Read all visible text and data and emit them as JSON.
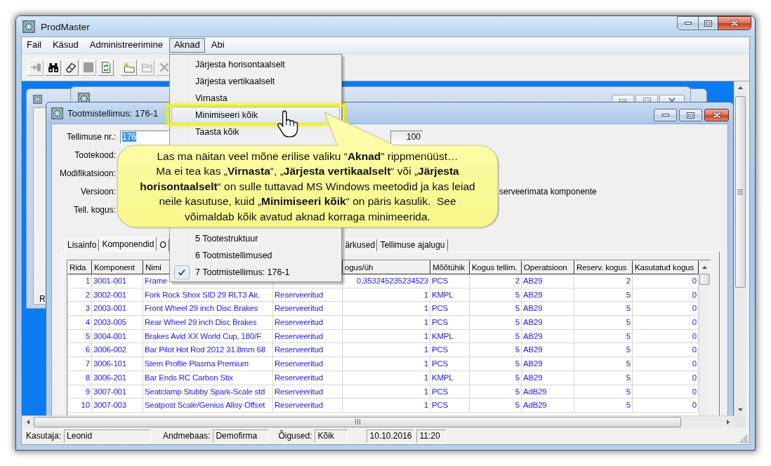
{
  "window": {
    "title": "ProdMaster"
  },
  "menu": [
    {
      "label": "Fail",
      "selected": false
    },
    {
      "label": "Käsud",
      "selected": false
    },
    {
      "label": "Administreerimine",
      "selected": false
    },
    {
      "label": "Aknad",
      "selected": true
    },
    {
      "label": "Abi",
      "selected": false
    }
  ],
  "toolbar": [
    {
      "kind": "enter",
      "disabled": true
    },
    {
      "kind": "binoculars",
      "disabled": false
    },
    {
      "kind": "eraser",
      "disabled": false
    },
    {
      "kind": "stop",
      "disabled": true
    },
    {
      "kind": "refresh",
      "disabled": false
    },
    {
      "kind": "new-folder",
      "disabled": false
    },
    {
      "kind": "folder",
      "disabled": true
    },
    {
      "kind": "delete",
      "disabled": true
    }
  ],
  "background_window": {
    "text": "R"
  },
  "document_window": {
    "title": "Tootmistellimus: 176-1",
    "fields": [
      {
        "label": "Tellimuse nr.:",
        "value": "176",
        "text_selected": true
      },
      {
        "label": "Tootekood:"
      },
      {
        "label": "Modifikatsioon:"
      },
      {
        "label": "Versioon:"
      },
      {
        "label": "Tell. kogus:"
      }
    ],
    "side_fields": [
      {
        "value": "100",
        "disabled": false
      }
    ],
    "option_text": "serveerimata komponente",
    "tabs": [
      {
        "label": "Lisainfo",
        "selected": false
      },
      {
        "label": "Komponendid",
        "selected": true
      },
      {
        "label": "O",
        "selected": false
      },
      {
        "label": "ärkused",
        "selected": false
      },
      {
        "label": "Tellimuse ajalugu",
        "selected": false
      }
    ],
    "table": {
      "columns": {
        "rida": "Rida",
        "komponent": "Komponent",
        "nimi": "Nimi",
        "kogus_uh": "ogus/üh",
        "mootuhik": "Mõõtühik",
        "kogus_tellim": "Kogus tellim.",
        "operatsioon": "Operatsioon",
        "reserv_kogus": "Reserv. kogus",
        "kasutatud_kogus": "Kasutatud kogus"
      },
      "rows": [
        {
          "rida": "1",
          "komponent": "3001-001",
          "nimi": "Frame",
          "kogus_uh": "0,353245235234523",
          "mootuhik": "PCS",
          "kogus_tellim": "2",
          "operatsioon": "AB29",
          "reserv_kogus": "2",
          "kasutatud_kogus": "0"
        },
        {
          "rida": "2",
          "komponent": "3002-001",
          "nimi": "Fork Rock Shox SID 29 RLT3 Air,",
          "column_4": "Reserveeritud",
          "kogus_uh": "1",
          "mootuhik": "KMPL",
          "kogus_tellim": "5",
          "operatsioon": "AB29",
          "reserv_kogus": "5",
          "kasutatud_kogus": "0"
        },
        {
          "rida": "3",
          "komponent": "2003-001",
          "nimi": "Front Wheel 29 inch Disc Brakes",
          "column_4": "Reserveeritud",
          "kogus_uh": "1",
          "mootuhik": "PCS",
          "kogus_tellim": "5",
          "operatsioon": "AB29",
          "reserv_kogus": "5",
          "kasutatud_kogus": "0"
        },
        {
          "rida": "4",
          "komponent": "2003-005",
          "nimi": "Rear Wheel 29 inch Disc Brakes",
          "column_4": "Reserveeritud",
          "kogus_uh": "1",
          "mootuhik": "PCS",
          "kogus_tellim": "5",
          "operatsioon": "AB29",
          "reserv_kogus": "5",
          "kasutatud_kogus": "0"
        },
        {
          "rida": "5",
          "komponent": "3004-001",
          "nimi": "Brakes Avid XX World Cup, 180/F",
          "column_4": "Reserveeritud",
          "kogus_uh": "1",
          "mootuhik": "KMPL",
          "kogus_tellim": "5",
          "operatsioon": "AB29",
          "reserv_kogus": "5",
          "kasutatud_kogus": "0"
        },
        {
          "rida": "6",
          "komponent": "3006-002",
          "nimi": "Bar Pilot Hot Rod 2012 31.8mm 68",
          "column_4": "Reserveeritud",
          "kogus_uh": "1",
          "mootuhik": "PCS",
          "kogus_tellim": "5",
          "operatsioon": "AB29",
          "reserv_kogus": "5",
          "kasutatud_kogus": "0"
        },
        {
          "rida": "7",
          "komponent": "3006-101",
          "nimi": "Stem Profile Plasma Premium",
          "column_4": "Reserveeritud",
          "kogus_uh": "1",
          "mootuhik": "PCS",
          "kogus_tellim": "5",
          "operatsioon": "AB29",
          "reserv_kogus": "5",
          "kasutatud_kogus": "0"
        },
        {
          "rida": "8",
          "komponent": "3006-201",
          "nimi": "Bar Ends RC Carbon Stix",
          "column_4": "Reserveeritud",
          "kogus_uh": "1",
          "mootuhik": "KMPL",
          "kogus_tellim": "5",
          "operatsioon": "AB29",
          "reserv_kogus": "5",
          "kasutatud_kogus": "0"
        },
        {
          "rida": "9",
          "komponent": "3007-001",
          "nimi": "Seatclamp Stubby Spark-Scale std",
          "column_4": "Reserveeritud",
          "kogus_uh": "1",
          "mootuhik": "PCS",
          "kogus_tellim": "5",
          "operatsioon": "AdB29",
          "reserv_kogus": "5",
          "kasutatud_kogus": "0"
        },
        {
          "rida": "10",
          "komponent": "3007-003",
          "nimi": "Seatpost Scale/Genius Alloy Offset",
          "column_4": "Reserveeritud",
          "kogus_uh": "1",
          "mootuhik": "PCS",
          "kogus_tellim": "5",
          "operatsioon": "AdB29",
          "reserv_kogus": "5",
          "kasutatud_kogus": "0"
        }
      ]
    }
  },
  "aknad_menu": {
    "items": [
      {
        "label": "Järjesta horisontaalselt",
        "selected": false
      },
      {
        "label": "Järjesta vertikaalselt",
        "selected": false
      },
      {
        "label": "Virnasta",
        "selected": false
      },
      {
        "label": "Minimiseeri kõik",
        "selected": true
      },
      {
        "label": "Taasta kõik",
        "selected": false
      }
    ],
    "window_items": [
      {
        "label": "5 Tootestruktuur",
        "selected": false,
        "checked": false
      },
      {
        "label": "6 Tootmistellimused",
        "selected": false,
        "checked": false
      },
      {
        "label": "7 Tootmistellimus: 176-1",
        "selected": false,
        "checked": true
      }
    ]
  },
  "callout": {
    "text": "Las ma näitan veel mõne erilise valiku “**Aknad**” rippmenüüst…\nMa ei tea kas „**Virnasta**“, „**Järjesta vertikaalselt**“ või „**Järjesta horisontaalselt**“ on sulle tuttavad MS Windows meetodid ja kas leiad neile kasutuse, kuid „**Minimiseeri kõik**“ on päris kasulik.  See võimaldab kõik avatud aknad korraga minimeerida."
  },
  "status_bar": [
    {
      "label": "Kasutaja:",
      "value": "Leonid"
    },
    {
      "label": "Andmebaas:",
      "value": "Demofirma"
    },
    {
      "label": "Õigused:",
      "value": "Kõik"
    },
    {
      "value": "10.10.2016"
    },
    {
      "value": "11:20"
    }
  ]
}
